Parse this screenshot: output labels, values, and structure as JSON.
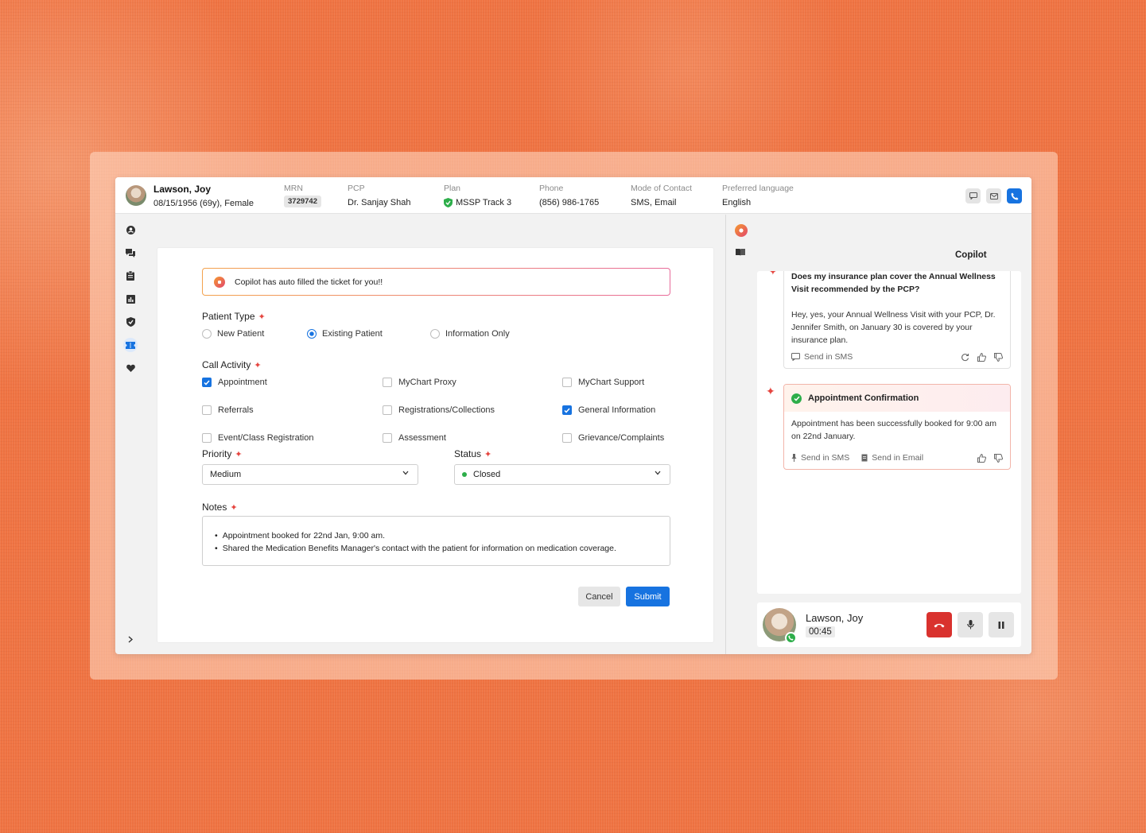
{
  "patient": {
    "name": "Lawson, Joy",
    "details": "08/15/1956 (69y), Female"
  },
  "header_fields": {
    "mrn": {
      "label": "MRN",
      "value": "3729742"
    },
    "pcp": {
      "label": "PCP",
      "value": "Dr. Sanjay Shah"
    },
    "plan": {
      "label": "Plan",
      "value": "MSSP Track 3"
    },
    "phone": {
      "label": "Phone",
      "value": "(856) 986-1765"
    },
    "contact": {
      "label": "Mode of Contact",
      "value": "SMS, Email"
    },
    "language": {
      "label": "Preferred language",
      "value": "English"
    }
  },
  "banner": "Copilot has auto filled the ticket for you!!",
  "patient_type": {
    "label": "Patient Type",
    "options": [
      {
        "label": "New Patient",
        "selected": false
      },
      {
        "label": "Existing Patient",
        "selected": true
      },
      {
        "label": "Information Only",
        "selected": false
      }
    ]
  },
  "call_activity": {
    "label": "Call Activity",
    "items": [
      {
        "label": "Appointment",
        "checked": true
      },
      {
        "label": "MyChart Proxy",
        "checked": false
      },
      {
        "label": "MyChart Support",
        "checked": false
      },
      {
        "label": "Referrals",
        "checked": false
      },
      {
        "label": "Registrations/Collections",
        "checked": false
      },
      {
        "label": "General Information",
        "checked": true
      },
      {
        "label": "Event/Class Registration",
        "checked": false
      },
      {
        "label": "Assessment",
        "checked": false
      },
      {
        "label": "Grievance/Complaints",
        "checked": false
      }
    ]
  },
  "priority": {
    "label": "Priority",
    "value": "Medium"
  },
  "status": {
    "label": "Status",
    "value": "Closed",
    "color": "#2dae4a"
  },
  "notes": {
    "label": "Notes",
    "lines": [
      "Appointment booked for 22nd Jan, 9:00 am.",
      "Shared the Medication Benefits Manager's contact with the patient for information on medication coverage."
    ]
  },
  "buttons": {
    "cancel": "Cancel",
    "submit": "Submit"
  },
  "copilot": {
    "title": "Copilot",
    "msg1": {
      "question": "Does my insurance plan cover the Annual Wellness Visit recommended by the PCP?",
      "answer": "Hey, yes, your Annual Wellness Visit with your PCP, Dr. Jennifer Smith, on January 30 is covered by your insurance plan.",
      "send_sms": "Send in SMS"
    },
    "msg2": {
      "title": "Appointment Confirmation",
      "body": "Appointment has been successfully booked for 9:00 am on 22nd January.",
      "send_sms": "Send in SMS",
      "send_email": "Send in Email"
    }
  },
  "call": {
    "name": "Lawson, Joy",
    "timer": "00:45"
  },
  "colors": {
    "primary": "#1773e0",
    "accent_red": "#e5453f",
    "hangup": "#d9322e",
    "success": "#2dae4a"
  }
}
